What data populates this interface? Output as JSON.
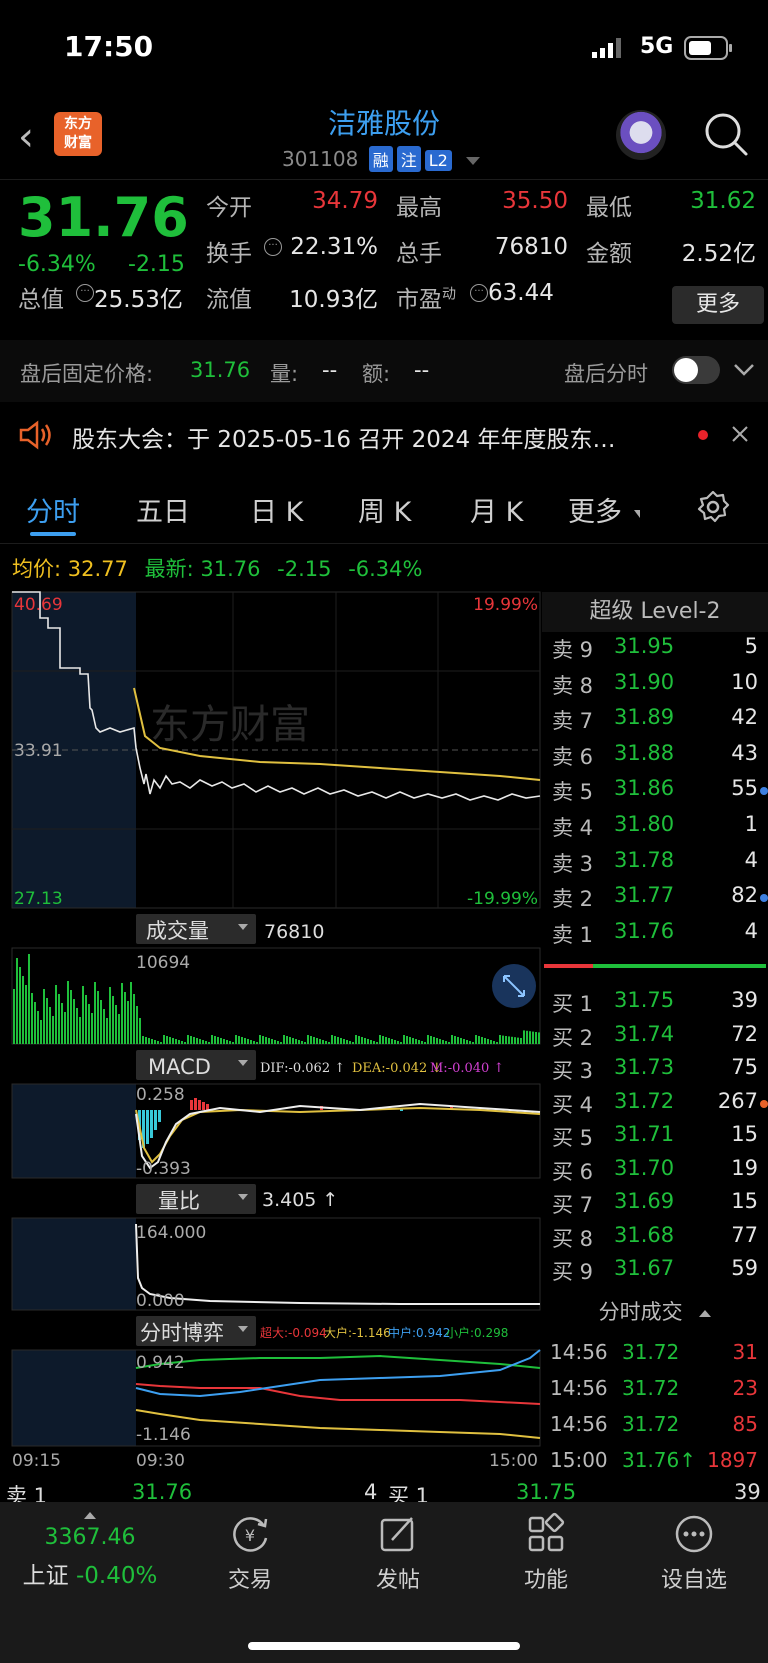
{
  "status_bar": {
    "time": "17:50",
    "network": "5G"
  },
  "header": {
    "logo_text_top": "东方",
    "logo_text_bottom": "财富",
    "stock_name": "洁雅股份",
    "stock_code": "301108",
    "tags": [
      "融",
      "注",
      "L2"
    ]
  },
  "quote": {
    "price": "31.76",
    "change_pct": "-6.34%",
    "change": "-2.15",
    "open_label": "今开",
    "open": "34.79",
    "high_label": "最高",
    "high": "35.50",
    "low_label": "最低",
    "low": "31.62",
    "turnover_label": "换手",
    "turnover": "22.31%",
    "volume_label": "总手",
    "volume": "76810",
    "amount_label": "金额",
    "amount": "2.52亿",
    "mktcap_label": "总值",
    "mktcap": "25.53亿",
    "float_label": "流值",
    "float": "10.93亿",
    "pe_label": "市盈",
    "pe_sup": "动",
    "pe": "63.44",
    "more_label": "更多"
  },
  "after_hours": {
    "label": "盘后固定价格:",
    "price": "31.76",
    "vol_label": "量:",
    "vol": "--",
    "amt_label": "额:",
    "amt": "--",
    "toggle_label": "盘后分时"
  },
  "notice": {
    "text": "股东大会：于 2025-05-16 召开 2024 年年度股东…"
  },
  "tabs": [
    "分时",
    "五日",
    "日 K",
    "周 K",
    "月 K",
    "更多"
  ],
  "avg_line": {
    "avg_label": "均价:",
    "avg": "32.77",
    "latest_label": "最新:",
    "latest": "31.76",
    "chg": "-2.15",
    "pct": "-6.34%"
  },
  "chart_labels": {
    "price_high": "40.69",
    "price_mid": "33.91",
    "price_low": "27.13",
    "pct_high": "19.99%",
    "pct_low": "-19.99%",
    "watermark": "东方财富",
    "vol_title": "成交量",
    "vol_total": "76810",
    "vol_max": "10694",
    "macd_title": "MACD",
    "dif": "DIF:-0.062 ↑",
    "dea": "DEA:-0.042 ↓",
    "m": "M:-0.040 ↑",
    "macd_top": "0.258",
    "macd_bottom": "-0.393",
    "lb_title": "量比",
    "lb_val": "3.405 ↑",
    "lb_top": "164.000",
    "lb_bottom": "0.000",
    "game_title": "分时博弈",
    "super": "超大:-0.094",
    "big": "大户:-1.146",
    "mid": "中户:0.942",
    "small": "小户:0.298",
    "game_top": "0.942",
    "game_bottom": "-1.146",
    "t_start": "09:15",
    "t_open": "09:30",
    "t_end": "15:00"
  },
  "order_book": {
    "title": "超级 Level-2",
    "asks": [
      {
        "n": "卖 9",
        "p": "31.95",
        "q": "5",
        "dot": ""
      },
      {
        "n": "卖 8",
        "p": "31.90",
        "q": "10",
        "dot": ""
      },
      {
        "n": "卖 7",
        "p": "31.89",
        "q": "42",
        "dot": ""
      },
      {
        "n": "卖 6",
        "p": "31.88",
        "q": "43",
        "dot": ""
      },
      {
        "n": "卖 5",
        "p": "31.86",
        "q": "55",
        "dot": "#3d7fe0"
      },
      {
        "n": "卖 4",
        "p": "31.80",
        "q": "1",
        "dot": ""
      },
      {
        "n": "卖 3",
        "p": "31.78",
        "q": "4",
        "dot": ""
      },
      {
        "n": "卖 2",
        "p": "31.77",
        "q": "82",
        "dot": "#3d7fe0"
      },
      {
        "n": "卖 1",
        "p": "31.76",
        "q": "4",
        "dot": ""
      }
    ],
    "bids": [
      {
        "n": "买 1",
        "p": "31.75",
        "q": "39",
        "dot": ""
      },
      {
        "n": "买 2",
        "p": "31.74",
        "q": "72",
        "dot": ""
      },
      {
        "n": "买 3",
        "p": "31.73",
        "q": "75",
        "dot": ""
      },
      {
        "n": "买 4",
        "p": "31.72",
        "q": "267",
        "dot": "#e8622a"
      },
      {
        "n": "买 5",
        "p": "31.71",
        "q": "15",
        "dot": ""
      },
      {
        "n": "买 6",
        "p": "31.70",
        "q": "19",
        "dot": ""
      },
      {
        "n": "买 7",
        "p": "31.69",
        "q": "15",
        "dot": ""
      },
      {
        "n": "买 8",
        "p": "31.68",
        "q": "77",
        "dot": ""
      },
      {
        "n": "买 9",
        "p": "31.67",
        "q": "59",
        "dot": ""
      }
    ],
    "trades_title": "分时成交",
    "trades": [
      {
        "t": "14:56",
        "p": "31.72",
        "v": "31"
      },
      {
        "t": "14:56",
        "p": "31.72",
        "v": "23"
      },
      {
        "t": "14:56",
        "p": "31.72",
        "v": "85"
      },
      {
        "t": "15:00",
        "p": "31.76↑",
        "v": "1897"
      }
    ]
  },
  "strip": {
    "ask_label": "卖 1",
    "ask_price": "31.76",
    "ask_qty": "4",
    "bid_label": "买 1",
    "bid_price": "31.75",
    "bid_qty": "39"
  },
  "bottom_bar": {
    "index_value": "3367.46",
    "index_name": "上证",
    "index_change": "-0.40%",
    "items": [
      "交易",
      "发帖",
      "功能",
      "设自选"
    ]
  },
  "colors": {
    "up": "#e8363a",
    "down": "#1fbf3b",
    "accent": "#3d9ff0",
    "avg_line": "#e0c040"
  }
}
